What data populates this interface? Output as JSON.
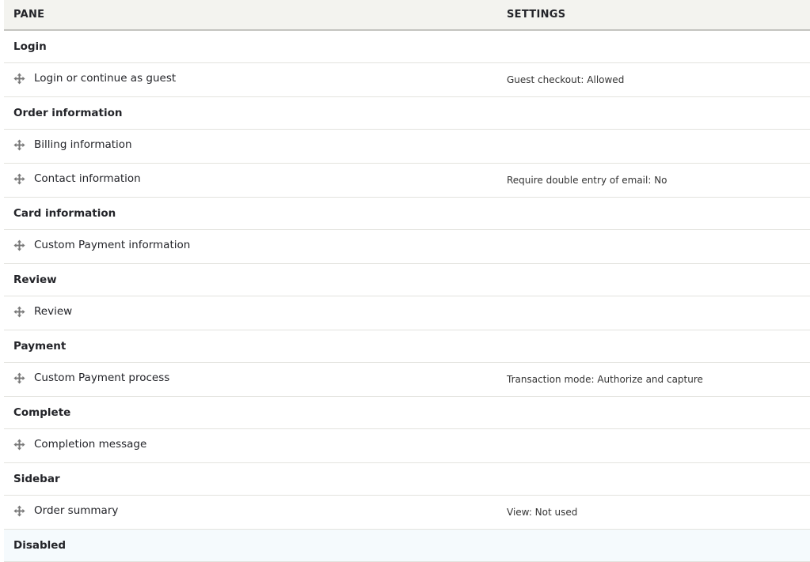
{
  "table": {
    "headers": {
      "pane": "PANE",
      "settings": "SETTINGS"
    },
    "regions": [
      {
        "label": "Login",
        "panes": [
          {
            "label": "Login or continue as guest",
            "settings": "Guest checkout: Allowed"
          }
        ]
      },
      {
        "label": "Order information",
        "panes": [
          {
            "label": "Billing information",
            "settings": ""
          },
          {
            "label": "Contact information",
            "settings": "Require double entry of email: No"
          }
        ]
      },
      {
        "label": "Card information",
        "panes": [
          {
            "label": "Custom Payment information",
            "settings": ""
          }
        ]
      },
      {
        "label": "Review",
        "panes": [
          {
            "label": "Review",
            "settings": ""
          }
        ]
      },
      {
        "label": "Payment",
        "panes": [
          {
            "label": "Custom Payment process",
            "settings": "Transaction mode: Authorize and capture"
          }
        ]
      },
      {
        "label": "Complete",
        "panes": [
          {
            "label": "Completion message",
            "settings": ""
          }
        ]
      },
      {
        "label": "Sidebar",
        "panes": [
          {
            "label": "Order summary",
            "settings": "View: Not used"
          }
        ]
      },
      {
        "label": "Disabled",
        "panes": []
      }
    ]
  },
  "icons": {
    "drag": "move-arrows-icon"
  }
}
